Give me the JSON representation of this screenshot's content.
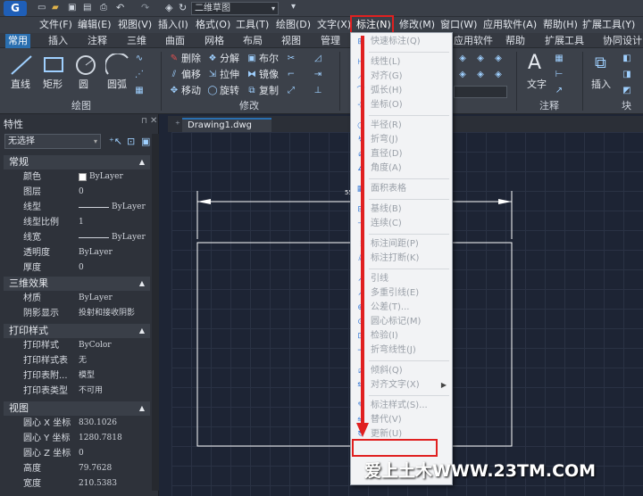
{
  "quick_access": {
    "workspace": "二维草图"
  },
  "menubar": [
    {
      "label": "文件(F)"
    },
    {
      "label": "编辑(E)"
    },
    {
      "label": "视图(V)"
    },
    {
      "label": "插入(I)"
    },
    {
      "label": "格式(O)"
    },
    {
      "label": "工具(T)"
    },
    {
      "label": "绘图(D)"
    },
    {
      "label": "文字(X)"
    },
    {
      "label": "标注(N)"
    },
    {
      "label": "修改(M)"
    },
    {
      "label": "窗口(W)"
    },
    {
      "label": "应用软件(A)"
    },
    {
      "label": "帮助(H)"
    },
    {
      "label": "扩展工具(Y)"
    }
  ],
  "ribbon_tabs": [
    {
      "label": "常用"
    },
    {
      "label": "插入"
    },
    {
      "label": "注释"
    },
    {
      "label": "三维"
    },
    {
      "label": "曲面"
    },
    {
      "label": "网格"
    },
    {
      "label": "布局"
    },
    {
      "label": "视图"
    },
    {
      "label": "管理"
    },
    {
      "label": "应用软件"
    },
    {
      "label": "帮助"
    },
    {
      "label": "扩展工具"
    },
    {
      "label": "协同设计"
    }
  ],
  "ribbon": {
    "draw": {
      "line": "直线",
      "rect": "矩形",
      "circle": "圆",
      "arc": "圆弧",
      "panel": "绘图"
    },
    "modify": {
      "erase": "删除",
      "explode": "分解",
      "array": "布尔",
      "offset": "偏移",
      "stretch": "拉伸",
      "mirror": "镜像",
      "move": "移动",
      "rotate": "旋转",
      "copy": "复制",
      "panel": "修改"
    },
    "annotate": {
      "text": "文字",
      "panel": "注释"
    },
    "block": {
      "insert": "插入",
      "panel": "块"
    }
  },
  "properties": {
    "title": "特性",
    "selection": "无选择",
    "sections": [
      {
        "name": "常规",
        "rows": [
          {
            "label": "颜色",
            "value": "ByLayer"
          },
          {
            "label": "图层",
            "value": "0"
          },
          {
            "label": "线型",
            "value": "ByLayer"
          },
          {
            "label": "线型比例",
            "value": "1"
          },
          {
            "label": "线宽",
            "value": "ByLayer"
          },
          {
            "label": "透明度",
            "value": "ByLayer"
          },
          {
            "label": "厚度",
            "value": "0"
          }
        ]
      },
      {
        "name": "三维效果",
        "rows": [
          {
            "label": "材质",
            "value": "ByLayer"
          },
          {
            "label": "阴影显示",
            "value": "投射和接收阴影"
          }
        ]
      },
      {
        "name": "打印样式",
        "rows": [
          {
            "label": "打印样式",
            "value": "ByColor"
          },
          {
            "label": "打印样式表",
            "value": "无"
          },
          {
            "label": "打印表附...",
            "value": "模型"
          },
          {
            "label": "打印表类型",
            "value": "不可用"
          }
        ]
      },
      {
        "name": "视图",
        "rows": [
          {
            "label": "圆心 X 坐标",
            "value": "830.1026"
          },
          {
            "label": "圆心 Y 坐标",
            "value": "1280.7818"
          },
          {
            "label": "圆心 Z 坐标",
            "value": "0"
          },
          {
            "label": "高度",
            "value": "79.7628"
          },
          {
            "label": "宽度",
            "value": "210.5383"
          }
        ]
      }
    ]
  },
  "drawing_tab": "Drawing1.dwg",
  "dim_menu": [
    {
      "label": "快速标注(Q)",
      "icon": "quick-dim-icon"
    },
    {
      "sep": true
    },
    {
      "label": "线性(L)",
      "icon": "linear-icon"
    },
    {
      "label": "对齐(G)",
      "icon": "aligned-icon"
    },
    {
      "label": "弧长(H)",
      "icon": "arc-length-icon"
    },
    {
      "label": "坐标(O)",
      "icon": "ordinate-icon"
    },
    {
      "sep": true
    },
    {
      "label": "半径(R)",
      "icon": "radius-icon"
    },
    {
      "label": "折弯(J)",
      "icon": "jogged-icon"
    },
    {
      "label": "直径(D)",
      "icon": "diameter-icon"
    },
    {
      "label": "角度(A)",
      "icon": "angle-icon"
    },
    {
      "sep": true
    },
    {
      "label": "面积表格",
      "icon": "area-table-icon"
    },
    {
      "sep": true
    },
    {
      "label": "基线(B)",
      "icon": "baseline-icon"
    },
    {
      "label": "连续(C)",
      "icon": "continue-icon"
    },
    {
      "sep": true
    },
    {
      "label": "标注间距(P)",
      "icon": "dim-space-icon"
    },
    {
      "label": "标注打断(K)",
      "icon": "dim-break-icon"
    },
    {
      "sep": true
    },
    {
      "label": "引线",
      "icon": "leader-icon"
    },
    {
      "label": "多重引线(E)",
      "icon": "mleader-icon"
    },
    {
      "label": "公差(T)...",
      "icon": "tolerance-icon"
    },
    {
      "label": "圆心标记(M)",
      "icon": "center-mark-icon"
    },
    {
      "label": "检验(I)",
      "icon": "inspect-icon"
    },
    {
      "label": "折弯线性(J)",
      "icon": "jogged-linear-icon"
    },
    {
      "sep": true
    },
    {
      "label": "倾斜(Q)",
      "icon": "oblique-icon"
    },
    {
      "label": "对齐文字(X)",
      "icon": "align-text-icon",
      "submenu": true
    },
    {
      "sep": true
    },
    {
      "label": "标注样式(S)...",
      "icon": "dim-style-icon"
    },
    {
      "label": "替代(V)",
      "icon": "override-icon"
    },
    {
      "label": "更新(U)",
      "icon": "update-icon"
    }
  ],
  "dimension_value": "55",
  "watermark": "爱上土木WWW.23TM.COM",
  "colors": {
    "accent": "#2a6fb0",
    "highlight": "#e02020",
    "arrow": "#e02020"
  }
}
